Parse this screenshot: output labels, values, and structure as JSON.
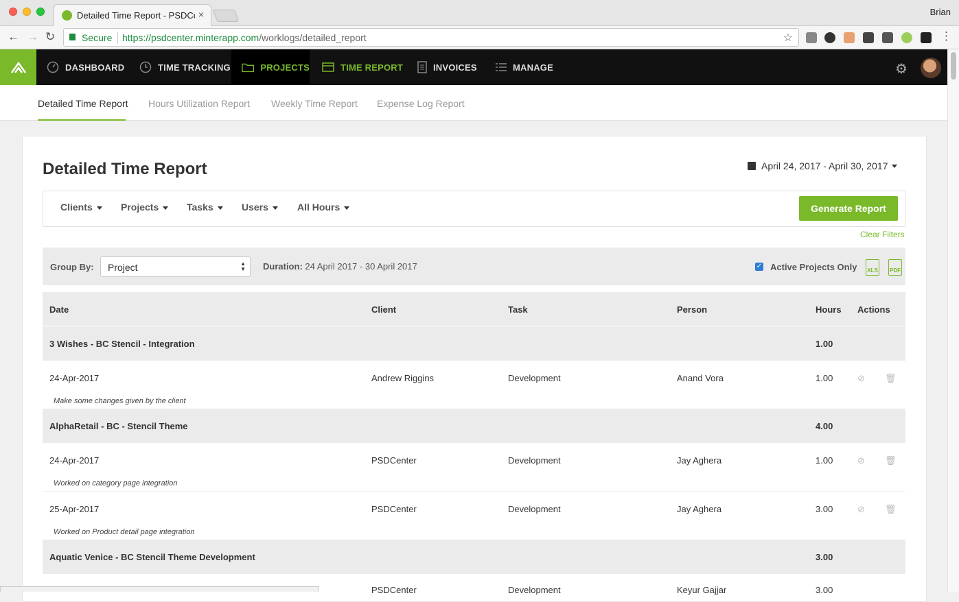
{
  "browser": {
    "tab_title": "Detailed Time Report - PSDCenter",
    "tab_close": "×",
    "user": "Brian",
    "secure_label": "Secure",
    "url_scheme": "https://",
    "url_host": "psdcenter.minterapp.com",
    "url_path": "/worklogs/detailed_report"
  },
  "nav": {
    "items": [
      {
        "label": "DASHBOARD",
        "icon": "gauge-icon"
      },
      {
        "label": "TIME TRACKING",
        "icon": "clock-icon"
      },
      {
        "label": "PROJECTS",
        "icon": "folder-icon"
      },
      {
        "label": "TIME REPORT",
        "icon": "report-icon"
      },
      {
        "label": "INVOICES",
        "icon": "document-icon"
      },
      {
        "label": "MANAGE",
        "icon": "list-icon"
      }
    ],
    "active": "PROJECTS",
    "accent": "#7ab929"
  },
  "subnav": {
    "tabs": [
      "Detailed Time Report",
      "Hours Utilization Report",
      "Weekly Time Report",
      "Expense Log Report"
    ],
    "active": "Detailed Time Report"
  },
  "report": {
    "title": "Detailed Time Report",
    "date_range": "April 24, 2017 - April 30, 2017",
    "filters": [
      "Clients",
      "Projects",
      "Tasks",
      "Users",
      "All Hours"
    ],
    "generate_label": "Generate Report",
    "clear_filters": "Clear Filters",
    "group_by_label": "Group By:",
    "group_by_value": "Project",
    "duration_label": "Duration:",
    "duration_value": "24 April 2017 - 30 April 2017",
    "active_projects_label": "Active Projects Only",
    "active_projects_checked": true,
    "export_xls": "XLS",
    "export_pdf": "PDF"
  },
  "table": {
    "headers": [
      "Date",
      "Client",
      "Task",
      "Person",
      "Hours",
      "Actions"
    ],
    "groups": [
      {
        "name": "3 Wishes - BC Stencil - Integration",
        "hours": "1.00",
        "entries": [
          {
            "date": "24-Apr-2017",
            "client": "Andrew Riggins",
            "task": "Development",
            "person": "Anand Vora",
            "hours": "1.00",
            "note": "Make some changes given by the client"
          }
        ]
      },
      {
        "name": "AlphaRetail - BC - Stencil Theme",
        "hours": "4.00",
        "entries": [
          {
            "date": "24-Apr-2017",
            "client": "PSDCenter",
            "task": "Development",
            "person": "Jay Aghera",
            "hours": "1.00",
            "note": "Worked on category page integration"
          },
          {
            "date": "25-Apr-2017",
            "client": "PSDCenter",
            "task": "Development",
            "person": "Jay Aghera",
            "hours": "3.00",
            "note": "Worked on Product detail page integration"
          }
        ]
      },
      {
        "name": "Aquatic Venice - BC Stencil Theme Development",
        "hours": "3.00",
        "entries": [
          {
            "date": "",
            "client": "PSDCenter",
            "task": "Development",
            "person": "Keyur Gajjar",
            "hours": "3.00",
            "note": ""
          }
        ]
      }
    ]
  }
}
